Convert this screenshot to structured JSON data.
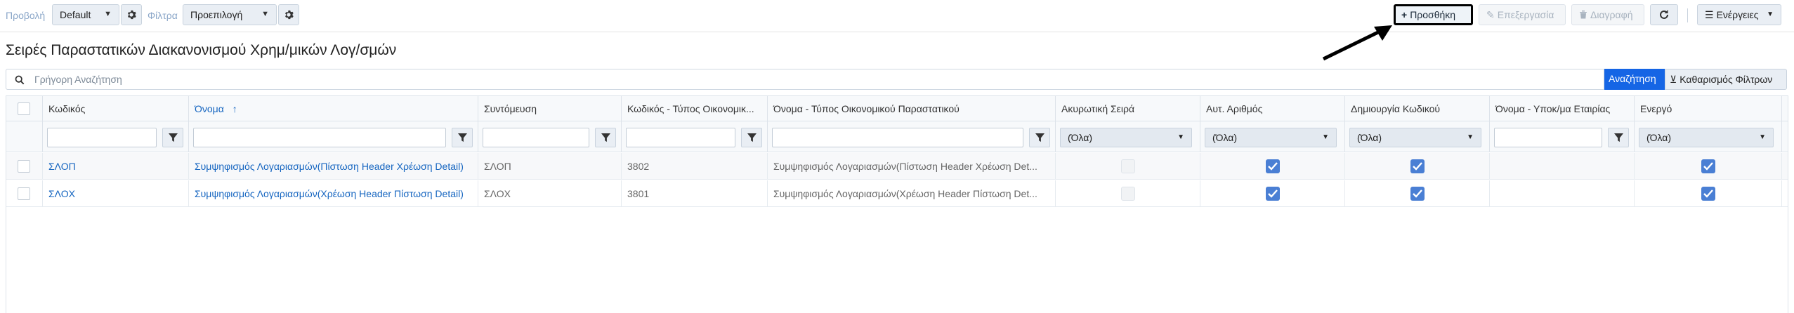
{
  "toolbar": {
    "view_label": "Προβολή",
    "view_value": "Default",
    "filters_label": "Φίλτρα",
    "filters_value": "Προεπιλογή",
    "add_label": "Προσθήκη",
    "edit_label": "Επεξεργασία",
    "delete_label": "Διαγραφή",
    "actions_label": "Ενέργειες"
  },
  "page": {
    "title": "Σειρές Παραστατικών Διακανονισμού Χρημ/μικών Λογ/σμών"
  },
  "search": {
    "placeholder": "Γρήγορη Αναζήτηση",
    "search_button": "Αναζήτηση",
    "clear_button": "Καθαρισμός Φίλτρων"
  },
  "grid": {
    "columns": [
      "Κωδικός",
      "Όνομα",
      "Συντόμευση",
      "Κωδικός - Τύπος Οικονομικ...",
      "Όνομα - Τύπος Οικονομικού Παραστατικού",
      "Ακυρωτική Σειρά",
      "Αυτ. Αριθμός",
      "Δημιουργία Κωδικού",
      "Όνομα - Υποκ/μα Εταιρίας",
      "Ενεργό"
    ],
    "sorted_column": "Όνομα",
    "sort_direction": "ascending",
    "filter_all_label": "(Όλα)",
    "rows": [
      {
        "code": "ΣΛΟΠ",
        "name": "Συμψηφισμός Λογαριασμών(Πίστωση Header Χρέωση Detail)",
        "shortcut": "ΣΛΟΠ",
        "doc_type_code": "3802",
        "doc_type_name": "Συμψηφισμός Λογαριασμών(Πίστωση Header Χρέωση Det...",
        "cancel_series": false,
        "auto_number": true,
        "create_code": true,
        "branch_name": "",
        "active": true
      },
      {
        "code": "ΣΛΟΧ",
        "name": "Συμψηφισμός Λογαριασμών(Χρέωση Header Πίστωση Detail)",
        "shortcut": "ΣΛΟΧ",
        "doc_type_code": "3801",
        "doc_type_name": "Συμψηφισμός Λογαριασμών(Χρέωση Header Πίστωση Det...",
        "cancel_series": false,
        "auto_number": true,
        "create_code": true,
        "branch_name": "",
        "active": true
      }
    ]
  },
  "colors": {
    "accent": "#1565e5",
    "link": "#1565c0",
    "checkbox_checked": "#4a7fd4"
  }
}
